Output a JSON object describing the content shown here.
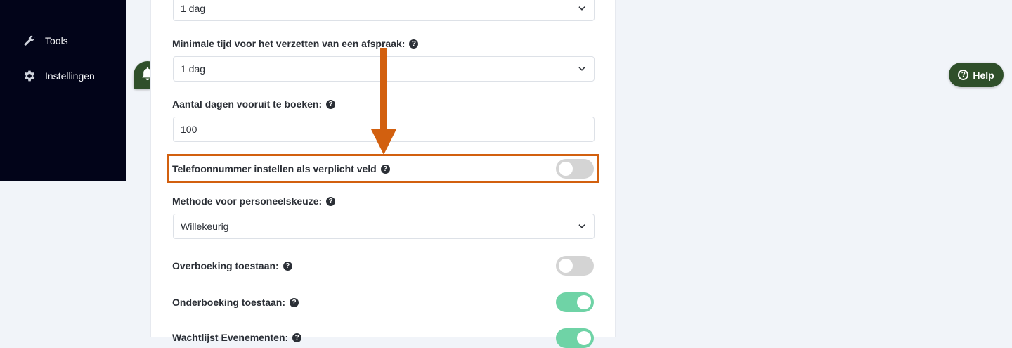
{
  "sidebar": {
    "items": [
      {
        "label": "Tools",
        "icon": "wrench-icon"
      },
      {
        "label": "Instellingen",
        "icon": "gear-icon"
      }
    ]
  },
  "form": {
    "top_select": {
      "value": "1 dag"
    },
    "min_reschedule": {
      "label": "Minimale tijd voor het verzetten van een afspraak:",
      "value": "1 dag"
    },
    "days_ahead": {
      "label": "Aantal dagen vooruit te boeken:",
      "value": "100"
    },
    "phone_required": {
      "label": "Telefoonnummer instellen als verplicht veld",
      "enabled": false
    },
    "staff_method": {
      "label": "Methode voor personeelskeuze:",
      "value": "Willekeurig"
    },
    "overbooking": {
      "label": "Overboeking toestaan:",
      "enabled": false
    },
    "underbooking": {
      "label": "Onderboeking toestaan:",
      "enabled": true
    },
    "waitlist": {
      "label": "Wachtlijst Evenementen:",
      "enabled": true
    }
  },
  "help": {
    "label": "Help"
  },
  "colors": {
    "accent": "#d2600f",
    "toggle_on": "#6fd3a6",
    "toggle_off": "#d4d4d4",
    "brand_green": "#2f4f2a",
    "sidebar_bg": "#020419"
  }
}
